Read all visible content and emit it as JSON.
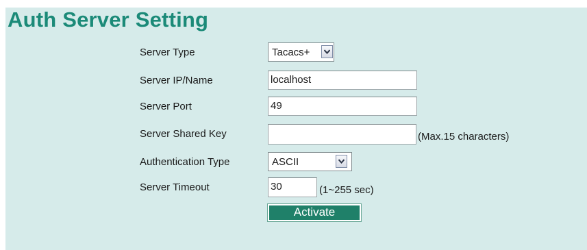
{
  "page": {
    "title": "Auth Server Setting"
  },
  "form": {
    "server_type": {
      "label": "Server Type",
      "selected": "Tacacs+",
      "arrow_icon": "chevron-down-icon"
    },
    "server_ip": {
      "label": "Server IP/Name",
      "value": "localhost"
    },
    "server_port": {
      "label": "Server Port",
      "value": "49"
    },
    "shared_key": {
      "label": "Server Shared Key",
      "value": "",
      "hint": "(Max.15 characters)"
    },
    "auth_type": {
      "label": "Authentication Type",
      "selected": "ASCII",
      "arrow_icon": "chevron-down-icon"
    },
    "timeout": {
      "label": "Server Timeout",
      "value": "30",
      "hint": "(1~255 sec)"
    },
    "activate_label": "Activate"
  },
  "colors": {
    "panel_background": "#d6ebea",
    "title": "#1b8a78",
    "button_background": "#1f8069",
    "button_text": "#ffffff"
  }
}
